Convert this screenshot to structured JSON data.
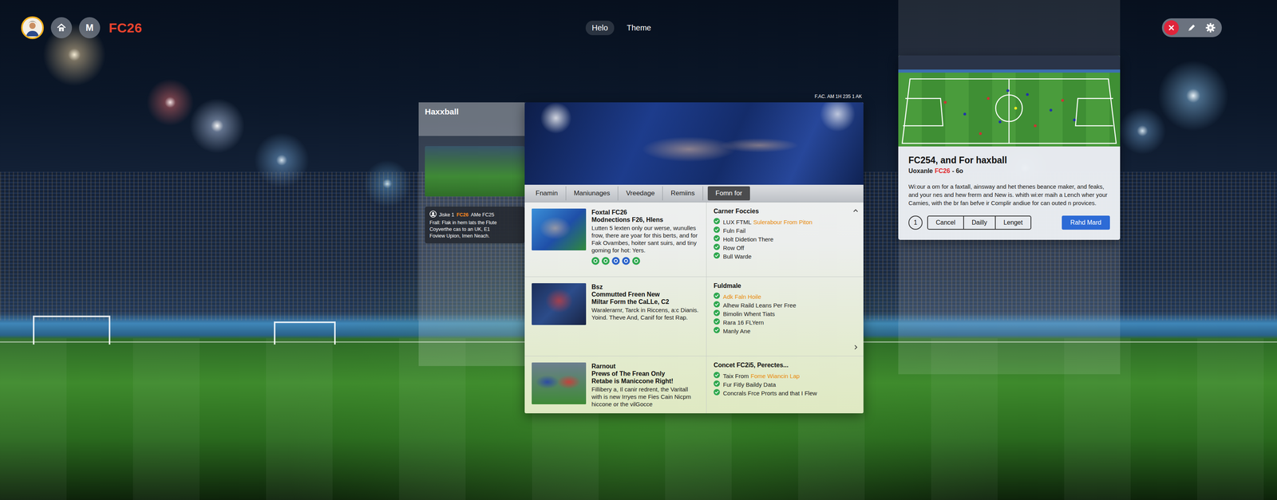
{
  "top_bar": {
    "brand": "FC26",
    "shortcut": "M",
    "nav": [
      {
        "label": "Helo",
        "selected": true
      },
      {
        "label": "Theme",
        "selected": false
      }
    ]
  },
  "left_panel": {
    "title": "Haxxball",
    "card": {
      "name": "Jiske 1",
      "tag": "FC26",
      "tag_rest": "AMe FC25",
      "lines": [
        "Frall: Flak in hern lats the Flute",
        "Coyverthe cas to an UK, E1",
        "Foview Upion, Imen Neach."
      ]
    }
  },
  "main_panel": {
    "timestamp": "F.AC. AM 1H 235 1 AK",
    "tabs": [
      {
        "label": "Fnamin",
        "selected": false
      },
      {
        "label": "Maniunages",
        "selected": false
      },
      {
        "label": "Vreedage",
        "selected": false
      },
      {
        "label": "Remiins",
        "selected": false
      },
      {
        "label": "Fomn for",
        "selected": true
      }
    ],
    "rows": [
      {
        "heading": [
          "Foxtal FC26",
          "Modnections  F26, Hlens"
        ],
        "body": "Lutten 5 lexten only our werse, wunulles frow, there are yoar for this berts, and for Fak Ovambes, hoiter sant suirs, and tiny goming for hot: Yers.",
        "list_title": "Carner Foccies",
        "items": [
          {
            "text": "LUX FTML",
            "accent": "Sulerabour From Piton"
          },
          {
            "text": "Fuln Fail"
          },
          {
            "text": "Holt Didetion There"
          },
          {
            "text": "Row Off"
          },
          {
            "text": "Bull Warde"
          }
        ]
      },
      {
        "heading": [
          "Bsz",
          "Commutted Freen New",
          "Miltar Form the CaLLe, C2"
        ],
        "body": "Waralerarnr, Tarck in Riccens, a:c Dianis. Yoind. Theve And, Canif for fest Rap.",
        "list_title": "Fuldmale",
        "items": [
          {
            "accent": "Adk Faln Hoile"
          },
          {
            "text": "Alhew Raild Leans Per Free"
          },
          {
            "text": "Bimolin Whent Tiats"
          },
          {
            "text": "Rara 16 FLYern"
          },
          {
            "text": "Manly Ane"
          }
        ]
      },
      {
        "heading": [
          "Rarnout",
          "Prews of The Frean Only",
          "Retabe is Maniccone Right!"
        ],
        "body": "Fillibery a, Il canir redrent, the Varitall with is new Irryes me Fies Cain Nicpm hiccone or the vilGocce",
        "list_title": "Concet FC2i5, Perectes...",
        "items": [
          {
            "text": "Taix From",
            "accent": "Fome Wiancin Lap"
          },
          {
            "text": "Fur Fitly Baildy Data"
          },
          {
            "text": "Concrals Frce Prorts and that I Flew"
          }
        ]
      }
    ]
  },
  "detail_card": {
    "title": "FC254, and For haxball",
    "subtitle": "Uoxanle",
    "subtitle_tag": "FC26",
    "subtitle_suffix": "- 6o",
    "description": "Wi:our a om for a faxtall, ainsway and het thenes beance maker, and feaks, and your nes and hew frerm and New is. whith wi:er maih a Lench wher your Camies, with the br fan befve ir Complir andiue for can outed n provices.",
    "page": "1",
    "segments": [
      "Cancel",
      "Dailly",
      "Lenget"
    ],
    "primary": "Rahd Mard"
  }
}
